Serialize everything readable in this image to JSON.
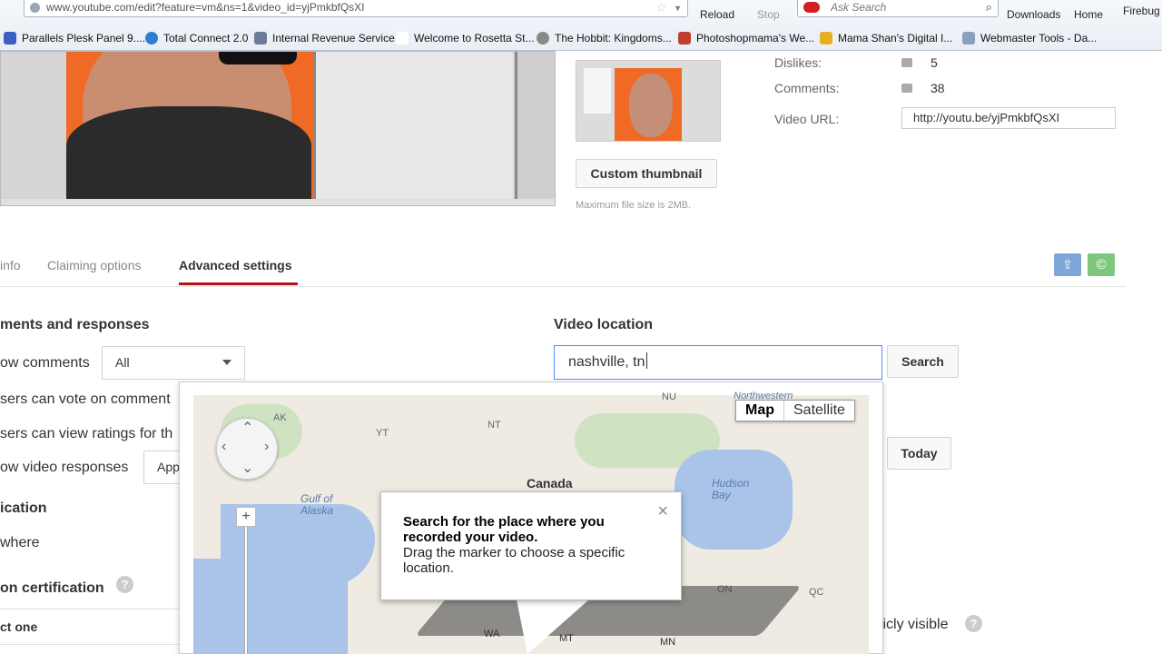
{
  "browser": {
    "url": "www.youtube.com/edit?feature=vm&ns=1&video_id=yjPmkbfQsXI",
    "reload_label": "Reload",
    "stop_label": "Stop",
    "search_placeholder": "Ask Search",
    "downloads_label": "Downloads",
    "home_label": "Home",
    "firebug_label": "Firebug",
    "bookmarks": [
      "Parallels Plesk Panel 9....",
      "Total Connect 2.0",
      "Internal Revenue Service",
      "Welcome to Rosetta St...",
      "The Hobbit: Kingdoms...",
      "Photoshopmama's We...",
      "Mama Shan's Digital I...",
      "Webmaster Tools - Da..."
    ]
  },
  "thumbnail": {
    "custom_label": "Custom thumbnail",
    "max_size": "Maximum file size is 2MB."
  },
  "stats": {
    "dislikes_label": "Dislikes:",
    "dislikes_value": "5",
    "comments_label": "Comments:",
    "comments_value": "38",
    "video_url_label": "Video URL:",
    "video_url_value": "http://youtu.be/yjPmkbfQsXI"
  },
  "tabs": {
    "info": "info",
    "claiming": "Claiming options",
    "advanced": "Advanced settings"
  },
  "left": {
    "comments_heading": "ments and responses",
    "allow_comments": "ow comments",
    "comments_value": "All",
    "vote_comments": "sers can vote on comment",
    "view_ratings": "sers can view ratings for th",
    "video_responses": "ow video responses",
    "responses_value": "App",
    "location_heading": "ication",
    "location_value": "where",
    "certification_heading": "on certification",
    "select_one": "ct one"
  },
  "location": {
    "heading": "Video location",
    "input_value": "nashville, tn",
    "search_label": "Search",
    "today_label": "Today",
    "publicly_visible": "blicly visible"
  },
  "map": {
    "type_map": "Map",
    "type_satellite": "Satellite",
    "labels": {
      "canada": "Canada",
      "gulf": "Gulf of Alaska",
      "hudson": "Hudson Bay",
      "ak": "AK",
      "yt": "YT",
      "nt": "NT",
      "nu": "NU",
      "on": "ON",
      "qc": "QC",
      "wa": "WA",
      "mt": "MT",
      "mn": "MN",
      "northwestern": "Northwestern"
    },
    "info_title": "Search for the place where you recorded your video.",
    "info_body": "Drag the marker to choose a specific location."
  }
}
